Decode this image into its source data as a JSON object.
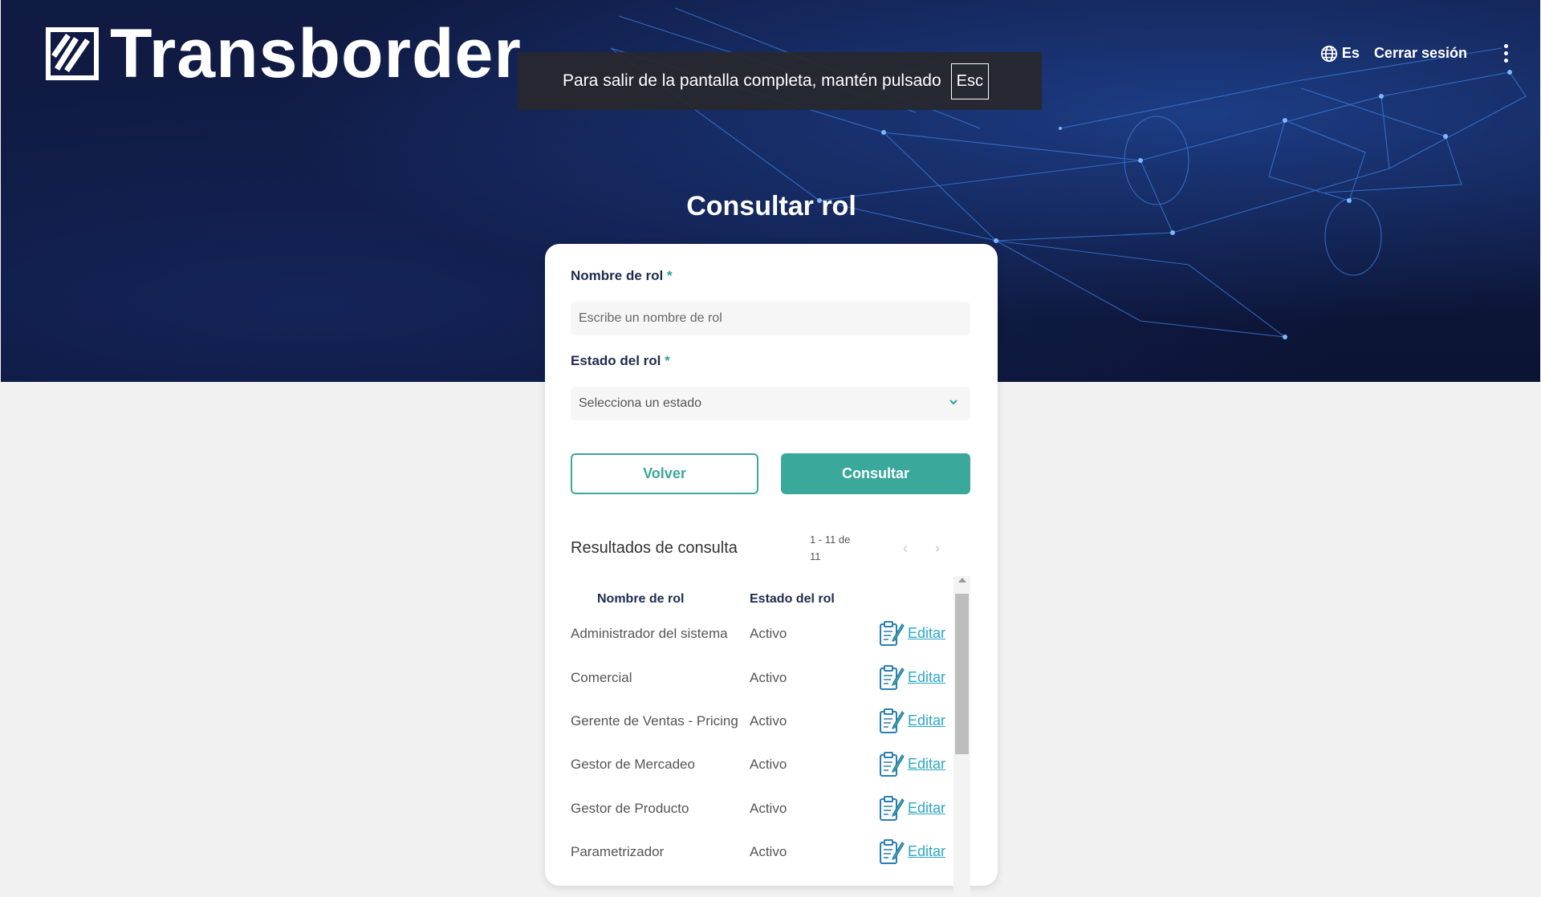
{
  "brand": {
    "name": "Transborder"
  },
  "fullscreen_banner": {
    "message": "Para salir de la pantalla completa, mantén pulsado",
    "key": "Esc"
  },
  "topnav": {
    "language": "Es",
    "logout": "Cerrar sesión"
  },
  "page": {
    "title": "Consultar rol"
  },
  "form": {
    "role_name_label": "Nombre de rol",
    "role_name_placeholder": "Escribe un nombre de rol",
    "role_state_label": "Estado del rol",
    "role_state_placeholder": "Selecciona un estado",
    "required_mark": "*",
    "back_button": "Volver",
    "search_button": "Consultar"
  },
  "results": {
    "title": "Resultados de consulta",
    "pager_text": "1 - 11 de 11",
    "columns": [
      "Nombre de rol",
      "Estado del rol"
    ],
    "edit_label": "Editar",
    "rows": [
      {
        "name": "Administrador del sistema",
        "state": "Activo"
      },
      {
        "name": "Comercial",
        "state": "Activo"
      },
      {
        "name": "Gerente de Ventas - Pricing",
        "state": "Activo"
      },
      {
        "name": "Gestor de Mercadeo",
        "state": "Activo"
      },
      {
        "name": "Gestor de Producto",
        "state": "Activo"
      },
      {
        "name": "Parametrizador",
        "state": "Activo"
      }
    ]
  },
  "colors": {
    "accent": "#3aa89b",
    "link": "#2aa8c4",
    "hero_bg": "#0f1a3f",
    "heading": "#1e2b4d"
  }
}
